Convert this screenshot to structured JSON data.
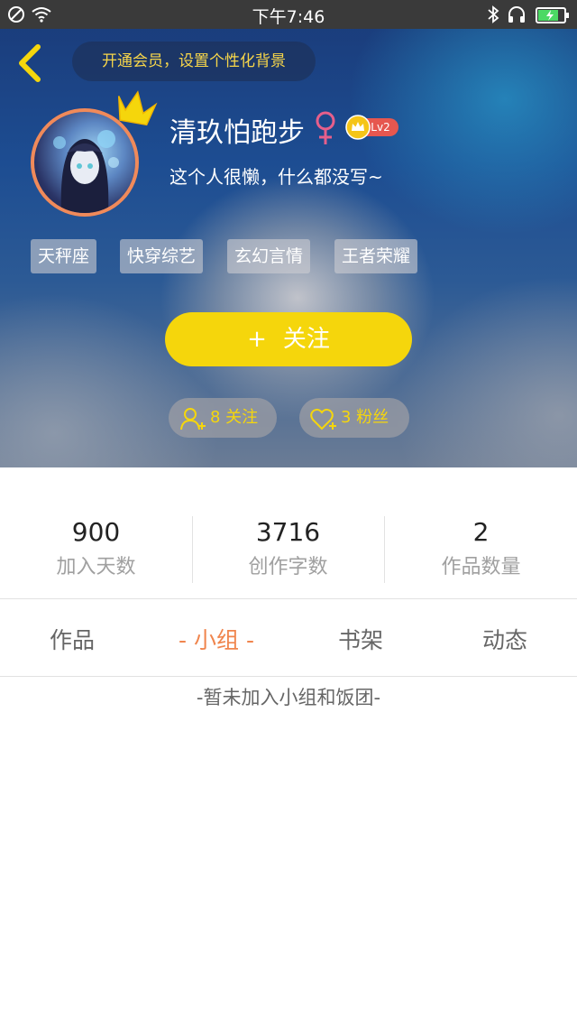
{
  "status_bar": {
    "time": "下午7:46",
    "icons_left": [
      "no-disturb-icon",
      "wifi-icon"
    ],
    "icons_right": [
      "bluetooth-icon",
      "headphones-icon",
      "battery-charging-icon"
    ]
  },
  "header": {
    "back_icon": "chevron-left-icon",
    "vip_promo": "开通会员，设置个性化背景"
  },
  "profile": {
    "username": "清玖怕跑步",
    "gender_symbol": "♀",
    "level": "Lv2",
    "bio": "这个人很懒，什么都没写~",
    "tags": [
      "天秤座",
      "快穿综艺",
      "玄幻言情",
      "王者荣耀"
    ]
  },
  "actions": {
    "follow_plus": "+",
    "follow_label": "关注",
    "following_count": "8 关注",
    "fans_count": "3 粉丝"
  },
  "stats": [
    {
      "value": "900",
      "label": "加入天数"
    },
    {
      "value": "3716",
      "label": "创作字数"
    },
    {
      "value": "2",
      "label": "作品数量"
    }
  ],
  "tabs": [
    {
      "label": "作品"
    },
    {
      "label": "- 小组 -",
      "active": true
    },
    {
      "label": "书架"
    },
    {
      "label": "动态"
    }
  ],
  "empty_message": "-暂未加入小组和饭团-",
  "colors": {
    "accent_yellow": "#f5d60c",
    "active_tab": "#f0854d",
    "level_badge": "#e6574f"
  }
}
